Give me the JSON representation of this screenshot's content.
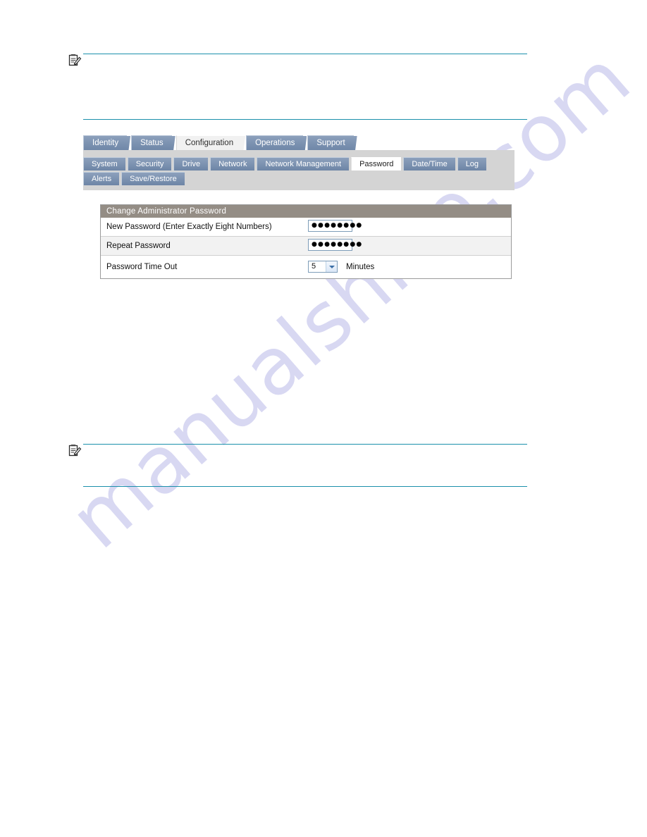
{
  "page": {
    "watermark_text": "manualshive.com",
    "rule_color": "#1b90ab",
    "accent_tab_color": "#7e94b2",
    "panel_header_color": "#948d85"
  },
  "notes": [
    {
      "icon": "note-pencil-icon",
      "position": "top"
    },
    {
      "icon": "note-pencil-icon",
      "position": "bottom"
    }
  ],
  "app": {
    "main_tabs": [
      {
        "label": "Identity",
        "active": false
      },
      {
        "label": "Status",
        "active": false
      },
      {
        "label": "Configuration",
        "active": true
      },
      {
        "label": "Operations",
        "active": false
      },
      {
        "label": "Support",
        "active": false
      }
    ],
    "sub_tabs_row1": [
      {
        "label": "System",
        "active": false
      },
      {
        "label": "Security",
        "active": false
      },
      {
        "label": "Drive",
        "active": false
      },
      {
        "label": "Network",
        "active": false
      },
      {
        "label": "Network Management",
        "active": false
      },
      {
        "label": "Password",
        "active": true
      },
      {
        "label": "Date/Time",
        "active": false
      },
      {
        "label": "Log",
        "active": false
      }
    ],
    "sub_tabs_row2": [
      {
        "label": "Alerts",
        "active": false
      },
      {
        "label": "Save/Restore",
        "active": false
      }
    ]
  },
  "panel": {
    "title": "Change Administrator Password",
    "rows": [
      {
        "label": "New Password (Enter Exactly Eight Numbers)",
        "field_type": "password",
        "value_mask": "●●●●●●●●",
        "char_count": 8
      },
      {
        "label": "Repeat Password",
        "field_type": "password",
        "value_mask": "●●●●●●●●",
        "char_count": 8
      },
      {
        "label": "Password Time Out",
        "field_type": "select",
        "value": "5",
        "unit": "Minutes"
      }
    ]
  }
}
